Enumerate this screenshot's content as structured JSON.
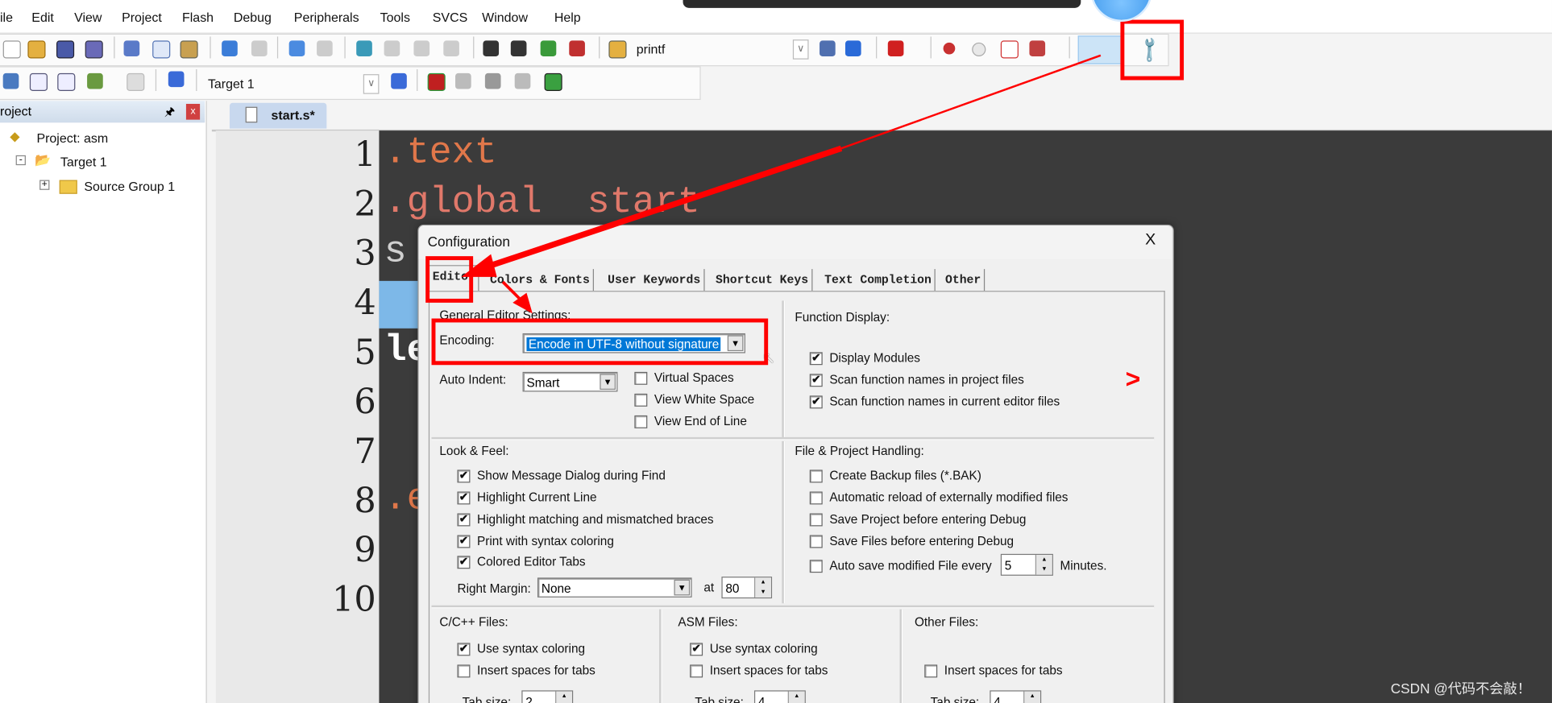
{
  "menu": [
    "ile",
    "Edit",
    "View",
    "Project",
    "Flash",
    "Debug",
    "Peripherals",
    "Tools",
    "SVCS",
    "Window",
    "Help"
  ],
  "toolbar1": {
    "find_text": "printf"
  },
  "toolbar2": {
    "target": "Target 1",
    "load_label": "LOAD"
  },
  "project_panel": {
    "title": "roject",
    "tree": [
      "Project: asm",
      "Target 1",
      "Source Group 1"
    ]
  },
  "editor": {
    "tab": "start.s*",
    "line_numbers": [
      "1",
      "2",
      "3",
      "4",
      "5",
      "6",
      "7",
      "8",
      "9",
      "10"
    ],
    "lines": [
      ".text",
      ".global  start",
      "s",
      "",
      "le",
      "",
      "",
      ".e",
      "",
      ""
    ]
  },
  "dialog": {
    "title": "Configuration",
    "close": "X",
    "tabs": [
      "Editor",
      "Colors & Fonts",
      "User Keywords",
      "Shortcut Keys",
      "Text Completion",
      "Other"
    ],
    "active_tab": "Editor",
    "general": {
      "heading": "General Editor Settings:",
      "encoding_label": "Encoding:",
      "encoding_value": "Encode in UTF-8 without signature",
      "auto_indent_label": "Auto Indent:",
      "auto_indent_value": "Smart",
      "options": [
        {
          "label": "Virtual Spaces",
          "checked": false
        },
        {
          "label": "View White Space",
          "checked": false
        },
        {
          "label": "View End of Line",
          "checked": false
        }
      ]
    },
    "function_display": {
      "heading": "Function Display:",
      "options": [
        {
          "label": "Display Modules",
          "checked": true
        },
        {
          "label": "Scan function names in project files",
          "checked": true
        },
        {
          "label": "Scan function names in current editor files",
          "checked": true
        }
      ]
    },
    "look_feel": {
      "heading": "Look & Feel:",
      "options": [
        {
          "label": "Show Message Dialog during Find",
          "checked": true
        },
        {
          "label": "Highlight Current Line",
          "checked": true
        },
        {
          "label": "Highlight matching and mismatched braces",
          "checked": true
        },
        {
          "label": "Print with syntax coloring",
          "checked": true
        },
        {
          "label": "Colored Editor Tabs",
          "checked": true
        }
      ],
      "right_margin_label": "Right Margin:",
      "right_margin_value": "None",
      "at_label": "at",
      "at_value": "80"
    },
    "file_project": {
      "heading": "File & Project Handling:",
      "options": [
        {
          "label": "Create Backup files (*.BAK)",
          "checked": false
        },
        {
          "label": "Automatic reload of externally modified files",
          "checked": false
        },
        {
          "label": "Save Project before entering Debug",
          "checked": false
        },
        {
          "label": "Save Files before entering Debug",
          "checked": false
        },
        {
          "label": "Auto save modified File every",
          "checked": false
        }
      ],
      "autosave_minutes": "5",
      "minutes_label": "Minutes."
    },
    "cpp_files": {
      "heading": "C/C++ Files:",
      "syntax": {
        "label": "Use syntax coloring",
        "checked": true
      },
      "spaces": {
        "label": "Insert spaces for tabs",
        "checked": false
      },
      "tab_size_label": "Tab size:",
      "tab_size": "2"
    },
    "asm_files": {
      "heading": "ASM Files:",
      "syntax": {
        "label": "Use syntax coloring",
        "checked": true
      },
      "spaces": {
        "label": "Insert spaces for tabs",
        "checked": false
      },
      "tab_size_label": "Tab size:",
      "tab_size": "4"
    },
    "other_files": {
      "heading": "Other Files:",
      "spaces": {
        "label": "Insert spaces for tabs",
        "checked": false
      },
      "tab_size_label": "Tab size:",
      "tab_size": "4"
    }
  },
  "annotation": {
    "color": "#ff0000",
    "arrow_glyph": ">"
  },
  "watermark": "CSDN @代码不会敲！",
  "colors": {
    "editor_bg": "#3b3b3b",
    "code_text": "#e0774a",
    "selection": "#0078d7"
  }
}
